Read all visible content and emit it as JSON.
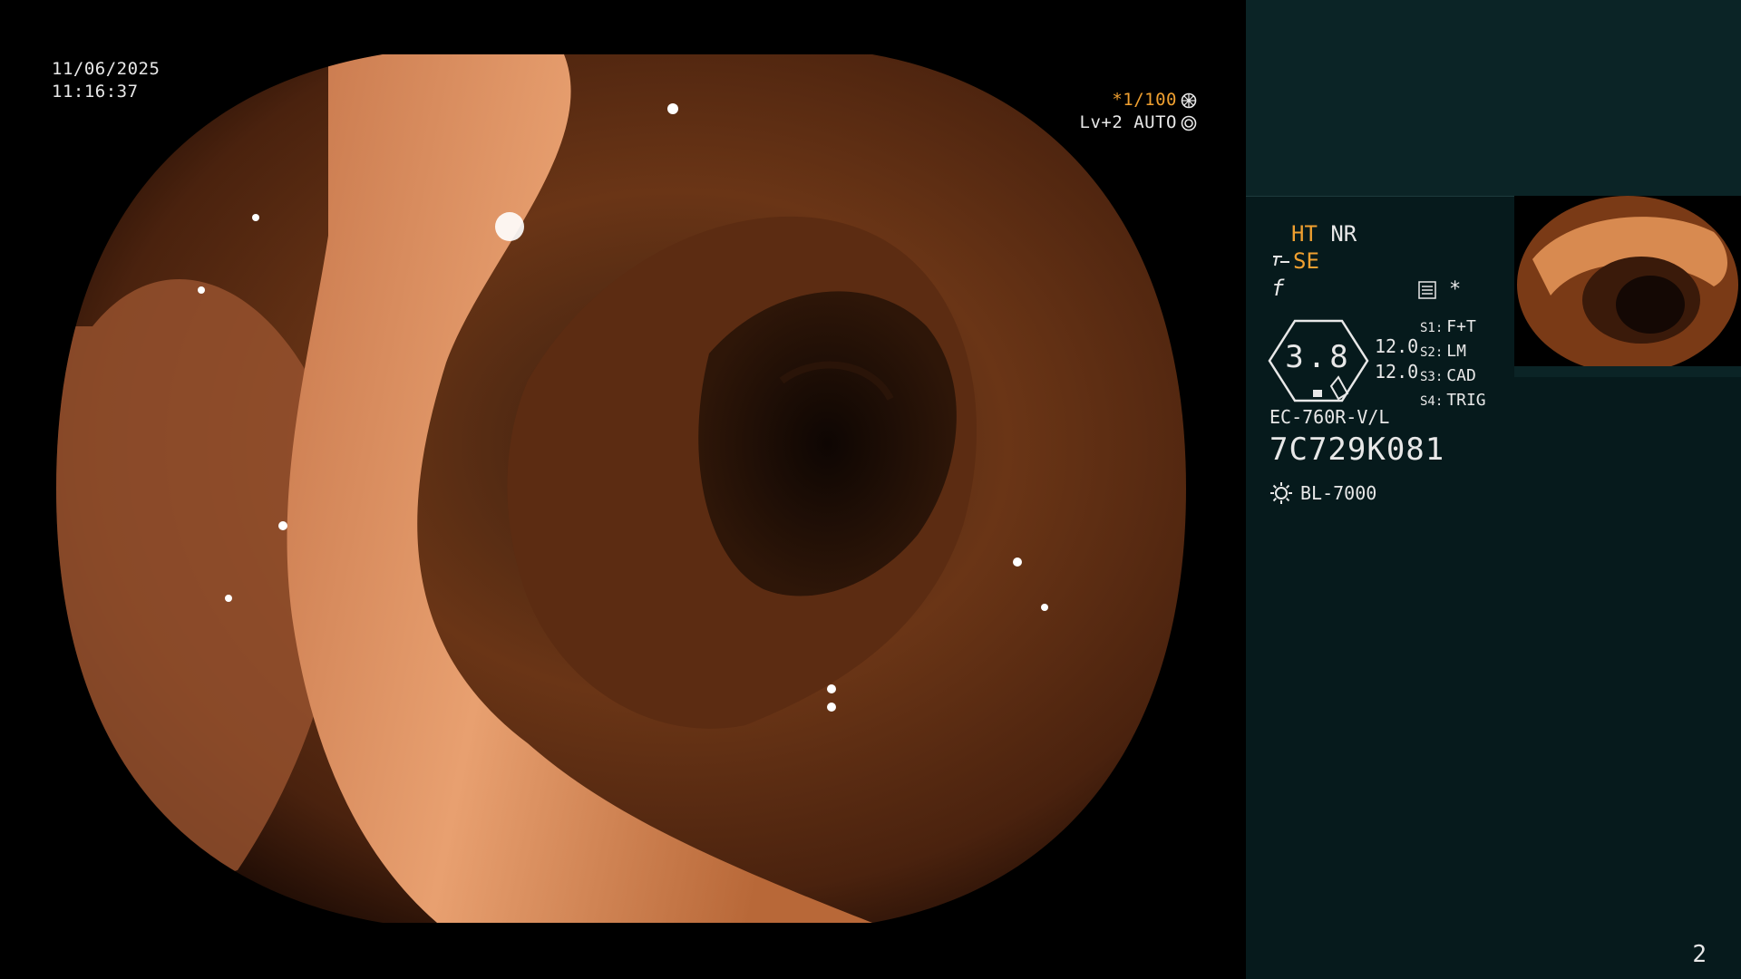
{
  "overlay": {
    "date": "11/06/2025",
    "time": "11:16:37",
    "shutter": "*1/100",
    "iris": "Lv+2 AUTO",
    "shutter_icon": "aperture-icon",
    "iris_icon": "iris-icon"
  },
  "panel": {
    "mode_ht": "HT",
    "mode_nr": "NR",
    "mode_se": "SE",
    "mode_f": "f",
    "star": "*",
    "gauge_value": "3.8",
    "values": [
      "12.0",
      "12.0"
    ],
    "switches": [
      {
        "key": "S1:",
        "label": "F+T"
      },
      {
        "key": "S2:",
        "label": "LM"
      },
      {
        "key": "S3:",
        "label": "CAD"
      },
      {
        "key": "S4:",
        "label": "TRIG"
      }
    ],
    "scope_model": "EC-760R-V/L",
    "scope_serial": "7C729K081",
    "light_source": "BL-7000",
    "page_number": "2"
  },
  "colors": {
    "background": "#000000",
    "panel_bg": "#061a1c",
    "panel_top_bg": "#0b2426",
    "accent_orange": "#f0a030",
    "text": "#e8e8e8"
  }
}
